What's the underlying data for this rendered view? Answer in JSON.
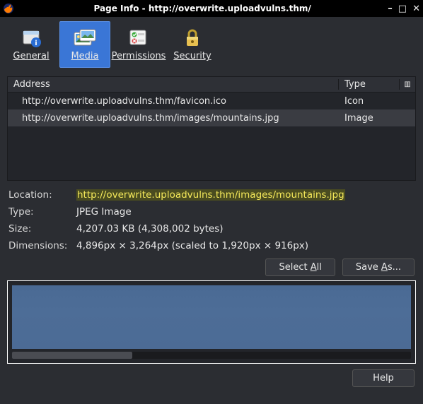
{
  "window": {
    "title": "Page Info - http://overwrite.uploadvulns.thm/"
  },
  "tabs": {
    "general": "General",
    "media": "Media",
    "permissions": "Permissions",
    "security": "Security"
  },
  "table": {
    "headers": {
      "address": "Address",
      "type": "Type"
    },
    "rows": [
      {
        "address": "http://overwrite.uploadvulns.thm/favicon.ico",
        "type": "Icon"
      },
      {
        "address": "http://overwrite.uploadvulns.thm/images/mountains.jpg",
        "type": "Image"
      }
    ]
  },
  "details": {
    "location_label": "Location:",
    "location_value": "http://overwrite.uploadvulns.thm/images/mountains.jpg",
    "type_label": "Type:",
    "type_value": "JPEG Image",
    "size_label": "Size:",
    "size_value": "4,207.03 KB (4,308,002 bytes)",
    "dim_label": "Dimensions:",
    "dim_value": "4,896px × 3,264px (scaled to 1,920px × 916px)"
  },
  "buttons": {
    "select_all_pre": "Select ",
    "select_all_accel": "A",
    "select_all_post": "ll",
    "save_as_pre": "Save ",
    "save_as_accel": "A",
    "save_as_post": "s...",
    "help": "Help"
  }
}
